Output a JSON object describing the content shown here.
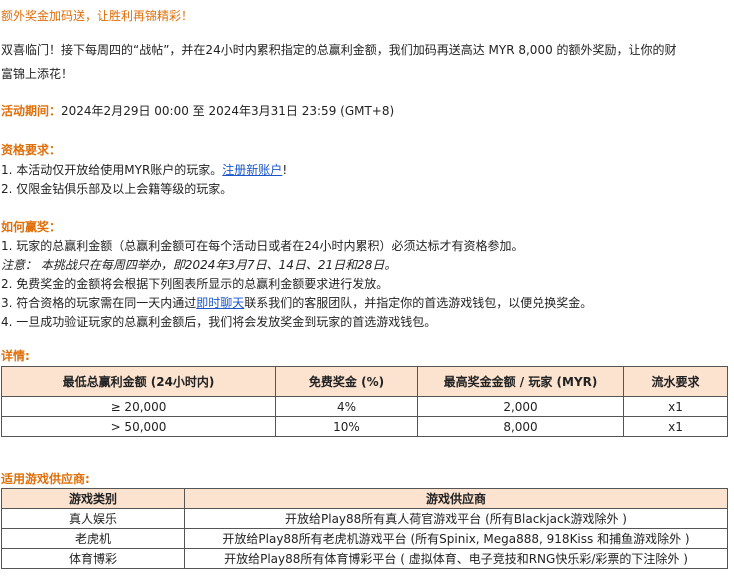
{
  "title": "额外奖金加码送，让胜利再锦精彩！",
  "intro_line1": "双喜临门！接下每周四的“战帖”，并在24小时内累积指定的总赢利金额，我们加码再送高达 MYR 8,000 的额外奖励，让你的财",
  "intro_line2": "富锦上添花！",
  "period": {
    "label": "活动期间：",
    "value": "2024年2月29日 00:00 至 2024年3月31日 23:59 (GMT+8)"
  },
  "eligibility": {
    "heading": "资格要求：",
    "item1_prefix": "1. 本活动仅开放给使用MYR账户的玩家。",
    "item1_link": "注册新账户",
    "item1_suffix": "!",
    "item2": "2. 仅限金钻俱乐部及以上会籍等级的玩家。"
  },
  "how_to_win": {
    "heading": "如何赢奖：",
    "item1": "1. 玩家的总赢利金额（总赢利金额可在每个活动日或者在24小时内累积）必须达标才有资格参加。",
    "note": "注意： 本挑战只在每周四举办，即2024年3月7日、14日、21日和28日。",
    "item2": "2. 免费奖金的金额将会根据下列图表所显示的总赢利金额要求进行发放。",
    "item3_prefix": "3. 符合资格的玩家需在同一天内通过",
    "item3_link": "即时聊天",
    "item3_suffix": "联系我们的客服团队，并指定你的首选游戏钱包，以便兑换奖金。",
    "item4": "4. 一旦成功验证玩家的总赢利金额后，我们将会发放奖金到玩家的首选游戏钱包。"
  },
  "details": {
    "heading": "详情:",
    "columns": [
      "最低总赢利金额 (24小时内)",
      "免费奖金 (%)",
      "最高奖金金额 / 玩家 (MYR)",
      "流水要求"
    ],
    "rows": [
      [
        "≥ 20,000",
        "4%",
        "2,000",
        "x1"
      ],
      [
        "> 50,000",
        "10%",
        "8,000",
        "x1"
      ]
    ]
  },
  "providers": {
    "heading": "适用游戏供应商:",
    "columns": [
      "游戏类别",
      "游戏供应商"
    ],
    "rows": [
      [
        "真人娱乐",
        "开放给Play88所有真人荷官游戏平台 (所有Blackjack游戏除外 )"
      ],
      [
        "老虎机",
        "开放给Play88所有老虎机游戏平台 (所有Spinix, Mega888, 918Kiss 和捕鱼游戏除外 )"
      ],
      [
        "体育博彩",
        "开放给Play88所有体育博彩平台 ( 虚拟体育、电子竞技和RNG快乐彩/彩票的下注除外 )"
      ]
    ]
  },
  "colors": {
    "accent": "#e06f0a",
    "link": "#1a56c9",
    "table_header_bg": "#fbe3d0"
  }
}
